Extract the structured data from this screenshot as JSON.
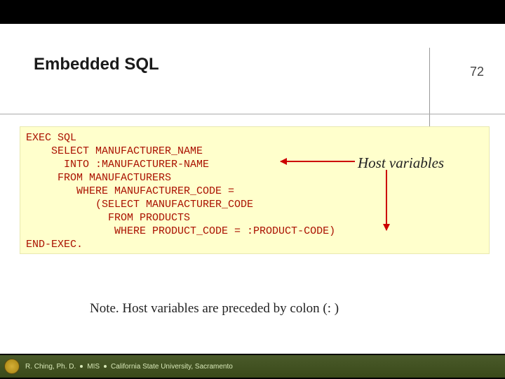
{
  "slide": {
    "title": "Embedded SQL",
    "page_number": "72",
    "annotation": "Host variables",
    "note": "Note.  Host variables are preceded by colon (: )"
  },
  "code": {
    "l1": "EXEC SQL",
    "l2": "    SELECT MANUFACTURER_NAME",
    "l3": "      INTO :MANUFACTURER-NAME",
    "l4": "     FROM MANUFACTURERS",
    "l5": "        WHERE MANUFACTURER_CODE =",
    "l6": "           (SELECT MANUFACTURER_CODE",
    "l7": "             FROM PRODUCTS",
    "l8": "              WHERE PRODUCT_CODE = :PRODUCT-CODE)",
    "l9": "END-EXEC."
  },
  "footer": {
    "author": "R. Ching, Ph. D.",
    "dept": "MIS",
    "org": "California State University, Sacramento"
  }
}
